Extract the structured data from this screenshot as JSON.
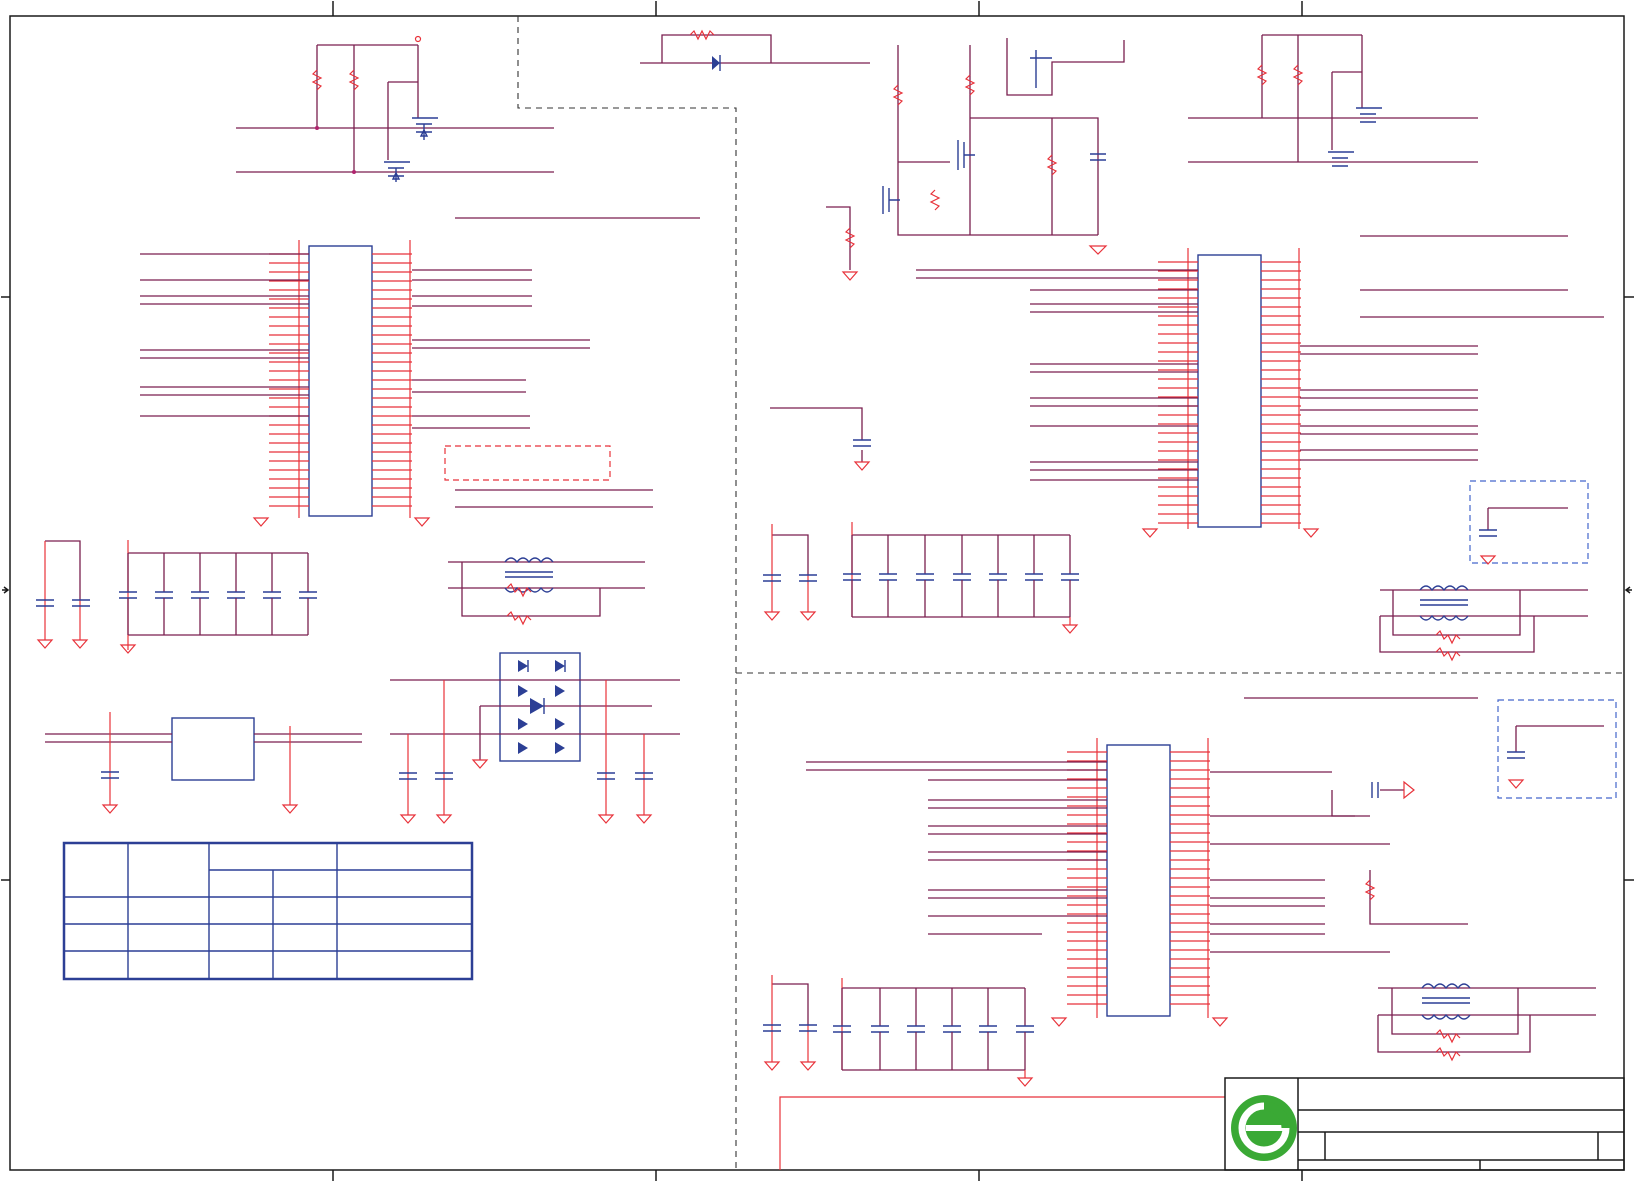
{
  "sheet": {
    "title_block": {
      "company_logo": "green-circular-logo",
      "text_fields": []
    }
  },
  "colors": {
    "wire": "#7a1f4f",
    "component": "#e8323a",
    "symbol": "#2c3f95",
    "logo": "#3aa935"
  }
}
